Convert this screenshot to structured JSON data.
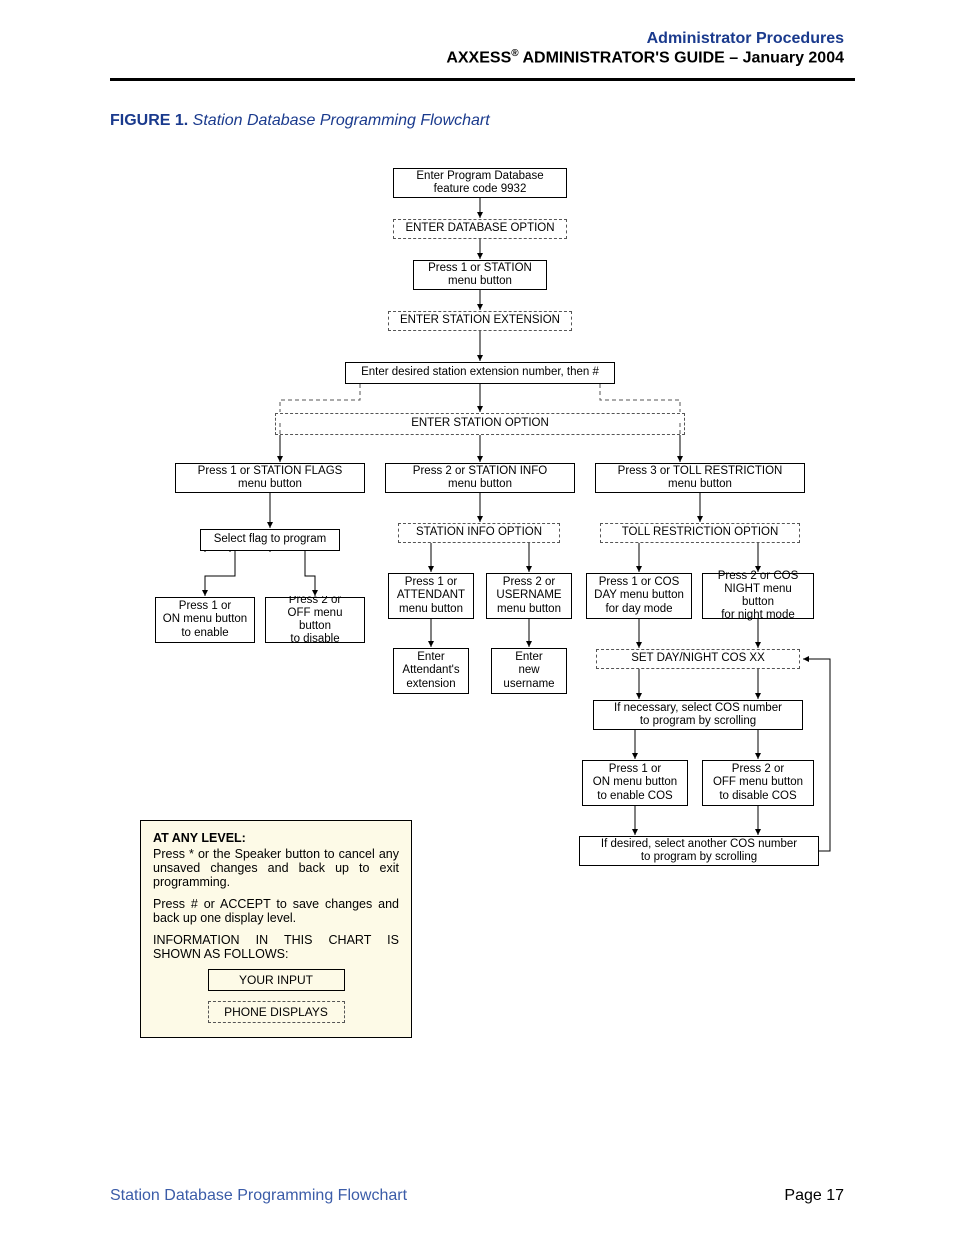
{
  "header": {
    "line1": "Administrator Procedures",
    "line2_prefix": "AXXESS",
    "line2_sup": "®",
    "line2_suffix": " ADMINISTRATOR'S GUIDE – January 2004"
  },
  "figure": {
    "label": "FIGURE 1.",
    "title": "  Station Database Programming Flowchart"
  },
  "footer": {
    "left": "Station Database Programming Flowchart",
    "right": "Page 17"
  },
  "boxes": {
    "b1": "Enter Program Database\nfeature code 9932",
    "d1": "ENTER DATABASE OPTION",
    "b2": "Press 1 or STATION\nmenu button",
    "d2": "ENTER STATION EXTENSION",
    "b3": "Enter desired station extension number, then #",
    "d3": "ENTER STATION OPTION",
    "b4": "Press 1 or STATION FLAGS\nmenu button",
    "b5": "Press 2 or STATION INFO\nmenu button",
    "b6": "Press 3 or TOLL RESTRICTION\nmenu button",
    "b7": "Select flag to program",
    "d4": "STATION INFO OPTION",
    "d5": "TOLL RESTRICTION OPTION",
    "b8": "Press 1 or\nON menu button\nto enable",
    "b9": "Press 2 or\nOFF menu button\nto disable",
    "b10": "Press 1 or\nATTENDANT\nmenu button",
    "b11": "Press 2 or\nUSERNAME\nmenu button",
    "b12": "Press 1 or COS\nDAY menu button\nfor day mode",
    "b13": "Press 2 or COS\nNIGHT menu button\nfor night mode",
    "d6": "SET DAY/NIGHT COS XX",
    "b14": "Enter\nAttendant's\nextension",
    "b15": "Enter\nnew\nusername",
    "b16": "If necessary, select COS number\nto program by scrolling",
    "b17": "Press 1 or\nON menu button\nto enable COS",
    "b18": "Press 2 or\nOFF menu button\nto disable COS",
    "b19": "If desired, select another COS number\nto program by scrolling"
  },
  "legend": {
    "heading": "AT ANY LEVEL:",
    "p1": "Press * or the Speaker button to cancel any unsaved changes and back up to exit programming.",
    "p2": "Press # or ACCEPT to save changes and back up one display level.",
    "p3": "INFORMATION IN THIS CHART IS SHOWN AS FOLLOWS:",
    "input": "YOUR INPUT",
    "display": "PHONE DISPLAYS"
  }
}
